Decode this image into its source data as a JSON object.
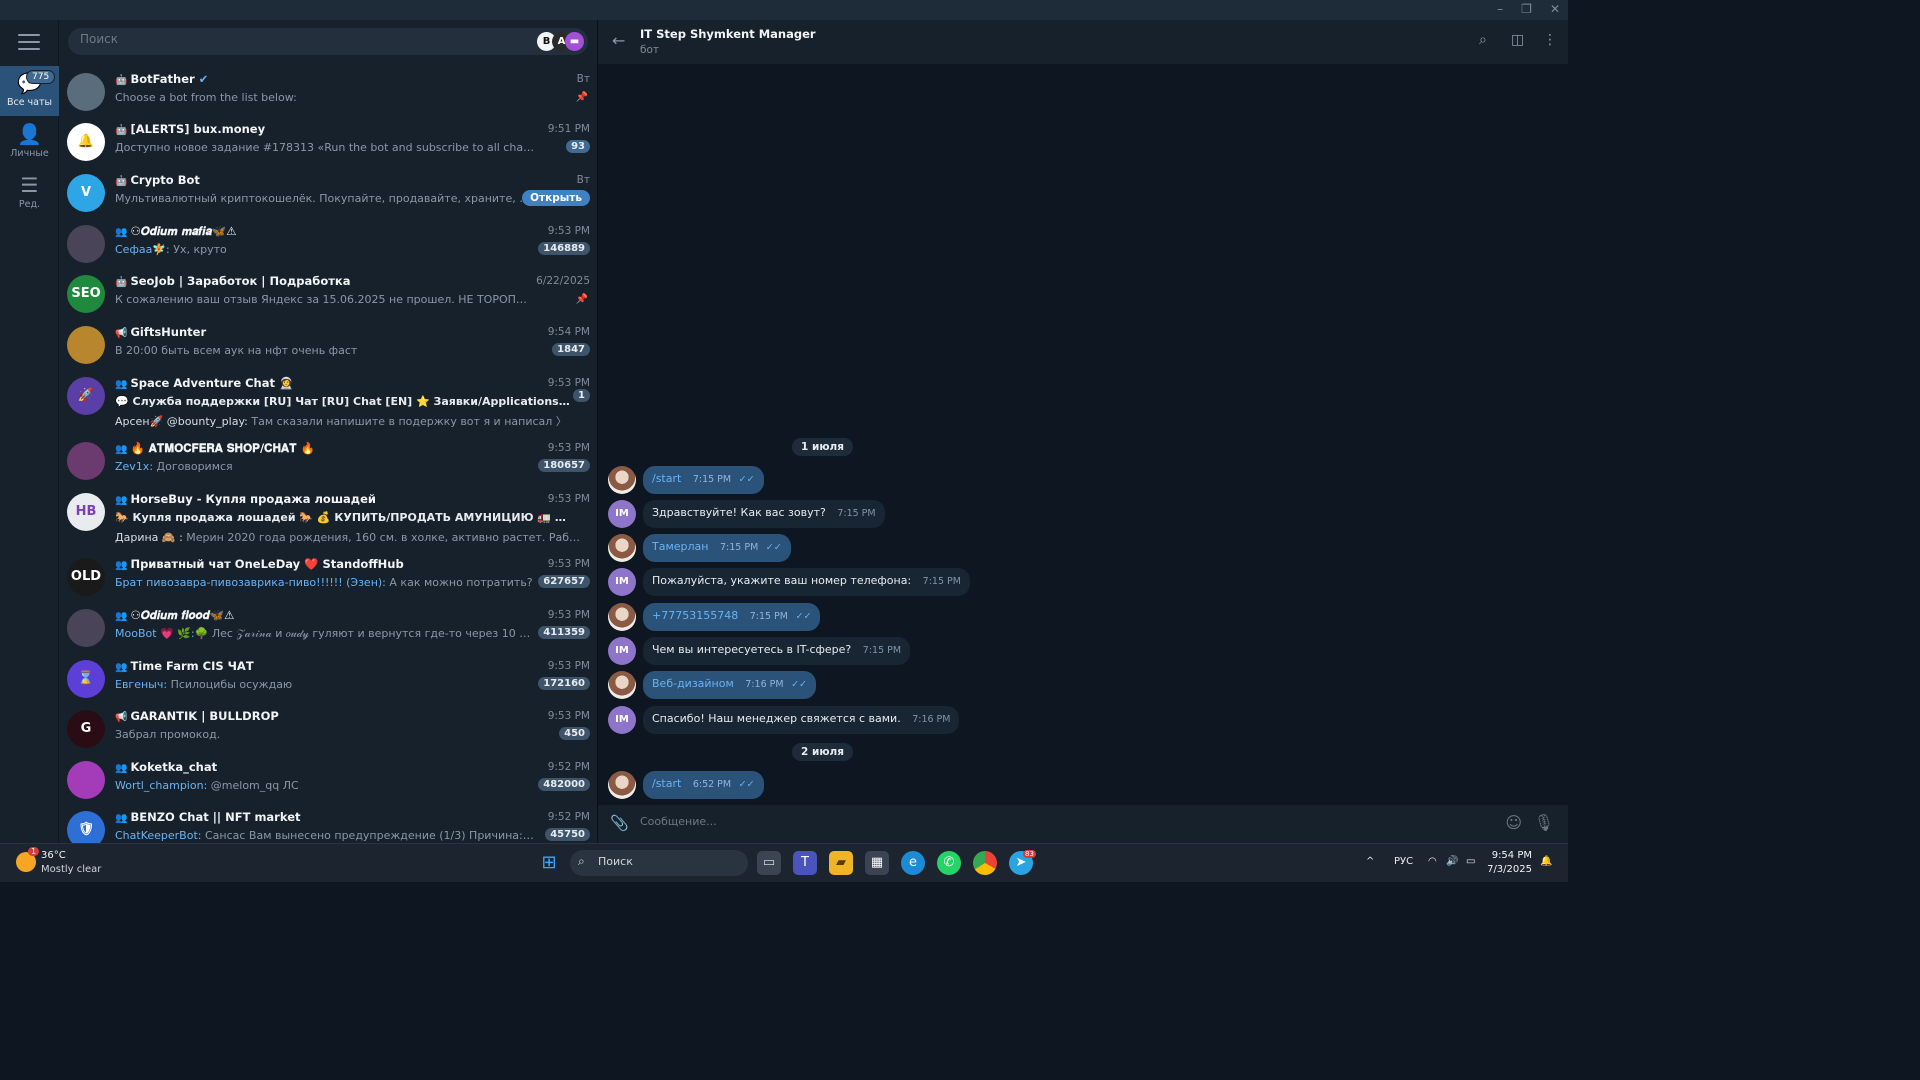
{
  "window": {
    "controls": [
      "–",
      "❐",
      "✕"
    ]
  },
  "rail": {
    "items": [
      {
        "label": "Все чаты",
        "badge": "775"
      },
      {
        "label": "Личные",
        "badge": ""
      },
      {
        "label": "Ред.",
        "badge": ""
      }
    ]
  },
  "search": {
    "placeholder": "Поиск"
  },
  "chats": [
    {
      "type": "bot",
      "name": "BotFather",
      "verified": "✔",
      "time": "Вт",
      "preview": "Choose a bot from the list below:",
      "sender": "",
      "count": "",
      "pinned": true,
      "avatar_text": "",
      "avatar_color": "#5a6d7c"
    },
    {
      "type": "bot",
      "name": "[ALERTS] bux.money",
      "time": "9:51 PM",
      "preview": "Доступно новое задание #178313 «Run the bot and subscribe to all channels» за 1 RUB За...",
      "sender": "",
      "count": "93",
      "count_style": "blue",
      "avatar_text": "🔔",
      "avatar_color": "#ffffff"
    },
    {
      "type": "bot",
      "name": "Crypto Bot",
      "time": "Вт",
      "preview": "Мультивалютный криптокошелёк. Покупайте, продавайте, храните, отправ...",
      "sender": "",
      "button": "Открыть",
      "avatar_text": "V",
      "avatar_color": "#2ea6e6"
    },
    {
      "type": "group",
      "name": "⚇𝑶𝒅𝒊𝒖𝒎 𝒎𝒂𝒇𝒊𝒂🦋⚠",
      "time": "9:53 PM",
      "preview": "Ух, круто",
      "sender": "Сефаа🧚:",
      "count": "146889",
      "avatar_text": "",
      "avatar_color": "#4a4458"
    },
    {
      "type": "bot",
      "name": "SeoJob | Заработок | Подработка",
      "time": "6/22/2025",
      "preview": "К сожалению ваш отзыв Яндекс за 15.06.2025 не прошел.  НЕ ТОРОПИТЕСЬ ПИСАТЬ В П...",
      "sender": "",
      "count": "",
      "pinned": true,
      "avatar_text": "SEO",
      "avatar_color": "#1f8a3e"
    },
    {
      "type": "channel",
      "name": "GiftsHunter",
      "time": "9:54 PM",
      "preview": "В 20:00 быть всем аук на нфт очень фаст",
      "sender": "",
      "count": "1847",
      "avatar_text": "",
      "avatar_color": "#b8862c"
    },
    {
      "type": "group",
      "name": "Space Adventure Chat 👩‍🚀",
      "time": "9:53 PM",
      "topics": "💬 Служба поддержки [RU]    Чат [RU]   Chat [EN]   ⭐ Заявки/Applications (на модера...",
      "preview": "Там сказали напишите в подержку вот я и написал 〉",
      "sender": "Арсен🚀 @bounty_play:",
      "count": "1",
      "avatar_text": "🚀",
      "avatar_color": "#5a3fa6"
    },
    {
      "type": "group",
      "name": "🔥 𝐀𝐓𝐌𝐎𝐂𝐅𝐄𝐑𝐀 𝐒𝐇𝐎𝐏/𝐂𝐇𝐀𝐓 🔥",
      "time": "9:53 PM",
      "preview": "Договоримся",
      "sender": "Zev1x:",
      "count": "180657",
      "avatar_text": "",
      "avatar_color": "#6b3a6e"
    },
    {
      "type": "group",
      "name": "HorseBuy - Купля продажа лошадей",
      "time": "9:53 PM",
      "topics": "🐎 Купля продажа лошадей 🐎    💰 КУПИТЬ/ПРОДАТЬ АМУНИЦИЮ    🚛 Транспортир...",
      "preview": "Мерин 2020 года рождения, 160 см. в холке, активно растет.  Работае... 〉",
      "sender": "Дарина 🙈 :",
      "count": "",
      "avatar_text": "HB",
      "avatar_color": "#e8ecef"
    },
    {
      "type": "group",
      "name": "Приватный чат OneLeDay ❤️ StandoffHub",
      "time": "9:53 PM",
      "preview": "А как можно потратить?",
      "sender": "Брат пивозавра-пивозаврика-пиво!!!!!! (Эзен):",
      "count": "627657",
      "avatar_text": "OLD",
      "avatar_color": "#1a1a1a"
    },
    {
      "type": "group",
      "name": "⚇𝑶𝒅𝒊𝒖𝒎 𝒇𝒍𝒐𝒐𝒅🦋⚠",
      "time": "9:53 PM",
      "preview": "Лес 𝒵𝒶𝓇𝒾𝓃𝒶 и 𝑜𝓊𝒹𝓎 гуляют и вернутся где-то через 10 минут...",
      "sender": "MooBot 💗 🌿:🌳",
      "count": "411359",
      "avatar_text": "",
      "avatar_color": "#4a4458"
    },
    {
      "type": "group",
      "name": "Time Farm CIS ЧАТ",
      "time": "9:53 PM",
      "preview": "Псилоцибы осуждаю",
      "sender": "Евгеныч:",
      "count": "172160",
      "avatar_text": "⌛",
      "avatar_color": "#5b3fd6"
    },
    {
      "type": "channel",
      "name": "GARANTIK | BULLDROP",
      "time": "9:53 PM",
      "preview": "Забрал  промокод.",
      "sender": "",
      "count": "450",
      "avatar_text": "G",
      "avatar_color": "#2a0d14"
    },
    {
      "type": "group",
      "name": "Koketka_chat",
      "time": "9:52 PM",
      "preview": "@melom_qq ЛС",
      "sender": "Wortl_champion:",
      "count": "482000",
      "avatar_text": "",
      "avatar_color": "#a43bb8"
    },
    {
      "type": "group",
      "name": "BENZO Chat || NFT market",
      "time": "9:52 PM",
      "preview": "Сансас Вам вынесено предупреждение (1/3) Причина: сообщение с...",
      "sender": "ChatKeeperBot:",
      "count": "45750",
      "avatar_text": "🛡",
      "avatar_color": "#2e6fd6"
    }
  ],
  "chat": {
    "title": "IT Step Shymkent Manager",
    "subtitle": "бот",
    "dates": [
      "1 июля",
      "2 июля"
    ],
    "messages": [
      {
        "dir": "out",
        "text": "/start",
        "time": "7:15 PM",
        "read": "✓✓"
      },
      {
        "dir": "in",
        "text": "Здравствуйте! Как вас зовут?",
        "time": "7:15 PM",
        "avatar": "IM"
      },
      {
        "dir": "out",
        "text": "Тамерлан",
        "time": "7:15 PM",
        "read": "✓✓"
      },
      {
        "dir": "in",
        "text": "Пожалуйста, укажите ваш номер телефона:",
        "time": "7:15 PM",
        "avatar": "IM"
      },
      {
        "dir": "out",
        "text": "+77753155748",
        "time": "7:15 PM",
        "read": "✓✓"
      },
      {
        "dir": "in",
        "text": "Чем вы интересуетесь в IT-сфере?",
        "time": "7:15 PM",
        "avatar": "IM"
      },
      {
        "dir": "out",
        "text": "Веб-дизайном",
        "time": "7:16 PM",
        "read": "✓✓"
      },
      {
        "dir": "in",
        "text": "Спасибо! Наш менеджер свяжется с вами.",
        "time": "7:16 PM",
        "avatar": "IM"
      },
      {
        "dir": "out",
        "text": "/start",
        "time": "6:52 PM",
        "read": "✓✓"
      }
    ],
    "composer_placeholder": "Сообщение..."
  },
  "taskbar": {
    "weather_temp": "36°C",
    "weather_cond": "Mostly clear",
    "weather_badge": "1",
    "search_placeholder": "Поиск",
    "lang": "РУС",
    "time": "9:54 PM",
    "date": "7/3/2025",
    "telegram_badge": "83"
  }
}
